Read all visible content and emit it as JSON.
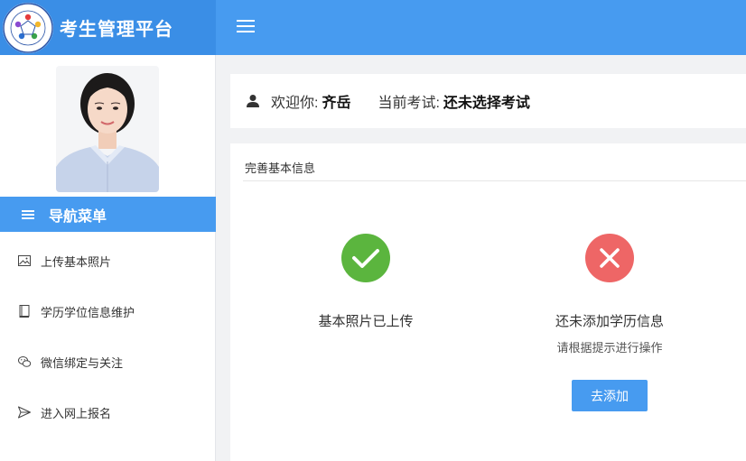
{
  "app": {
    "title": "考生管理平台",
    "logo_icon": "university-logo"
  },
  "colors": {
    "primary": "#479bf0",
    "brand_bg": "#3a8ee6",
    "success": "#5bb53e",
    "error": "#ee6666"
  },
  "sidebar": {
    "nav_title": "导航菜单",
    "items": [
      {
        "label": "上传基本照片",
        "icon": "image-icon"
      },
      {
        "label": "学历学位信息维护",
        "icon": "book-icon"
      },
      {
        "label": "微信绑定与关注",
        "icon": "wechat-icon"
      },
      {
        "label": "进入网上报名",
        "icon": "send-icon"
      }
    ]
  },
  "welcome": {
    "greeting": "欢迎你:",
    "user_name": "齐岳",
    "exam_label": "当前考试:",
    "exam_value": "还未选择考试"
  },
  "card": {
    "title": "完善基本信息",
    "photo_status": {
      "icon": "check-circle-icon",
      "message": "基本照片已上传"
    },
    "education_status": {
      "icon": "close-circle-icon",
      "message": "还未添加学历信息",
      "hint": "请根据提示进行操作",
      "button_label": "去添加"
    }
  }
}
